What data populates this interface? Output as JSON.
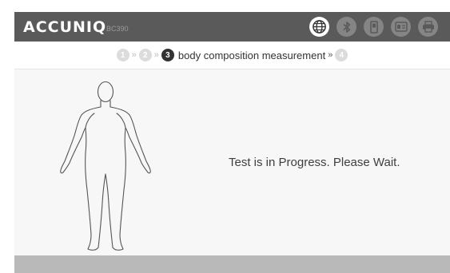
{
  "header": {
    "brand": "ACCUNIQ",
    "model": "BC390",
    "icons": [
      "globe-icon",
      "bluetooth-icon",
      "device-icon",
      "id-card-icon",
      "printer-icon"
    ]
  },
  "steps": {
    "items": [
      {
        "number": "1",
        "state": "inactive"
      },
      {
        "number": "2",
        "state": "inactive"
      },
      {
        "number": "3",
        "state": "active",
        "label": "body composition measurement"
      },
      {
        "number": "4",
        "state": "inactive"
      }
    ]
  },
  "main": {
    "status": "Test is in Progress. Please Wait."
  },
  "colors": {
    "topbar": "#5a5a5a",
    "bottombar": "#b9b9b9",
    "active_step": "#333333",
    "inactive_step": "#dcdcdc"
  }
}
